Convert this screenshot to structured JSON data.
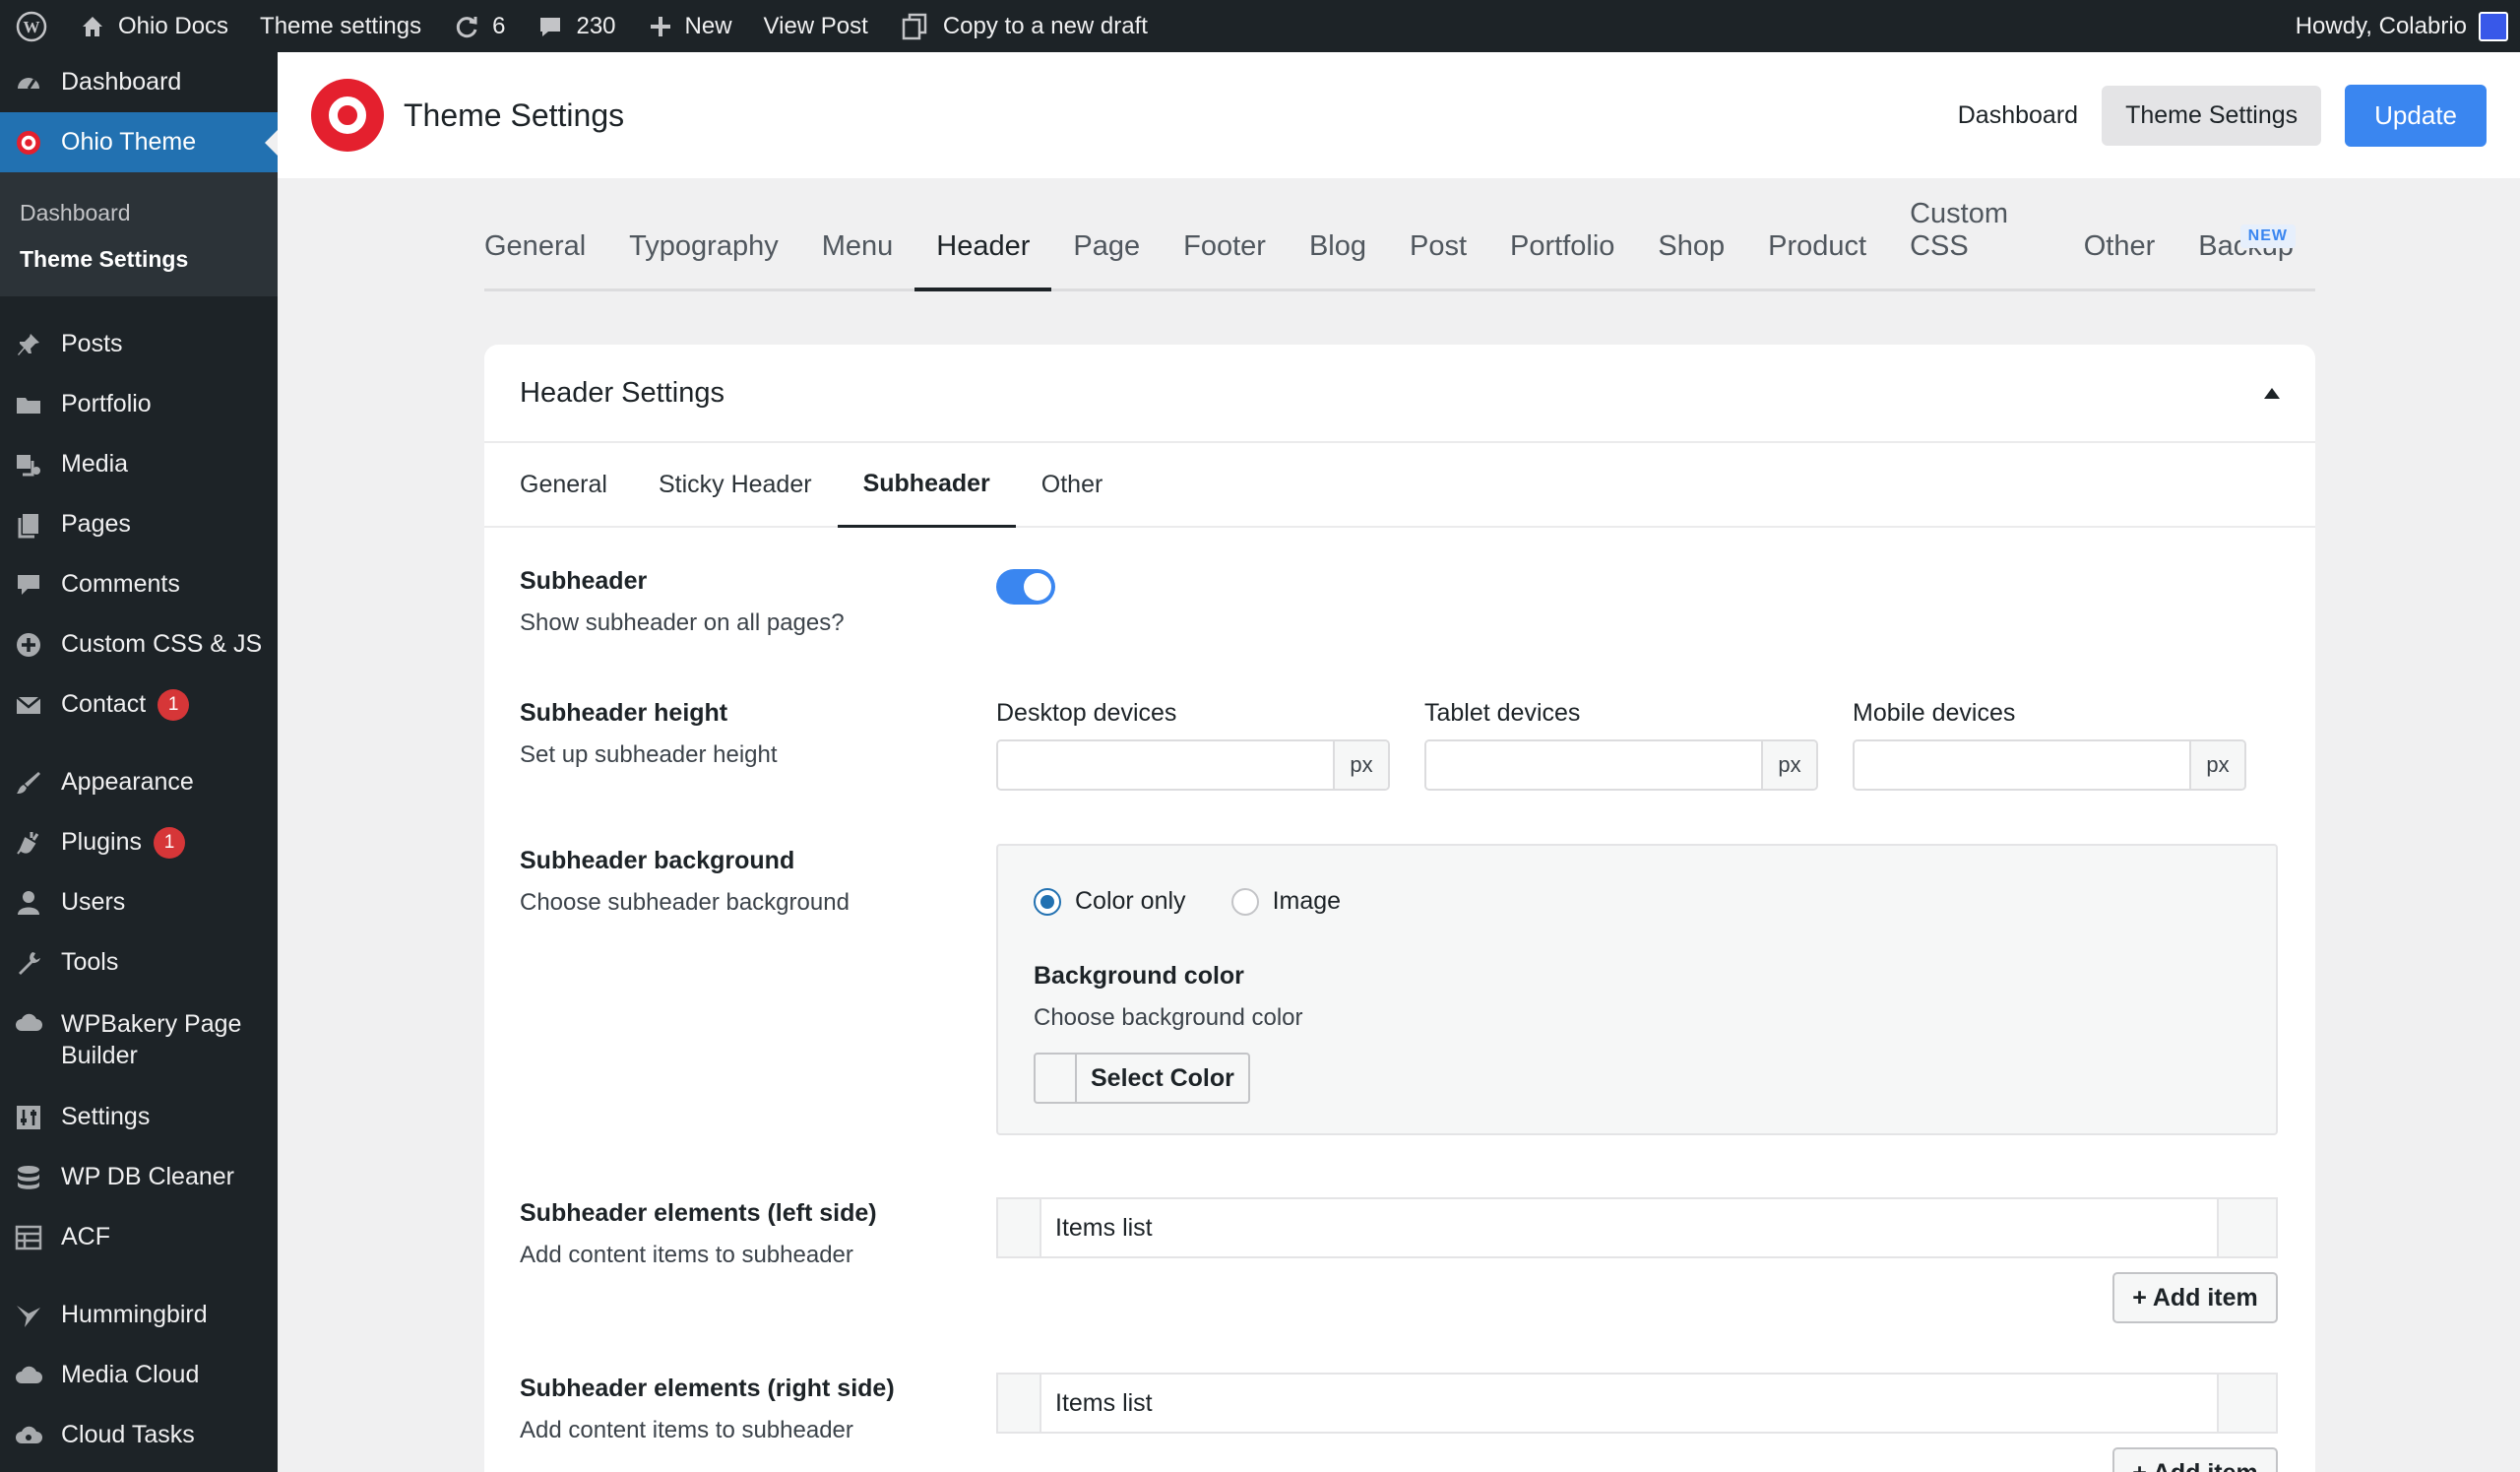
{
  "adminbar": {
    "site_name": "Ohio Docs",
    "theme_settings": "Theme settings",
    "updates_count": "6",
    "comments_count": "230",
    "new_label": "New",
    "view_post": "View Post",
    "copy_draft": "Copy to a new draft",
    "howdy": "Howdy, Colabrio"
  },
  "sidebar": {
    "dashboard": "Dashboard",
    "ohio_theme": "Ohio Theme",
    "sub_dashboard": "Dashboard",
    "sub_theme_settings": "Theme Settings",
    "posts": "Posts",
    "portfolio": "Portfolio",
    "media": "Media",
    "pages": "Pages",
    "comments": "Comments",
    "custom_css_js": "Custom CSS & JS",
    "contact": "Contact",
    "contact_badge": "1",
    "appearance": "Appearance",
    "plugins": "Plugins",
    "plugins_badge": "1",
    "users": "Users",
    "tools": "Tools",
    "wpbakery": "WPBakery Page Builder",
    "settings": "Settings",
    "wp_db_cleaner": "WP DB Cleaner",
    "acf": "ACF",
    "hummingbird": "Hummingbird",
    "media_cloud": "Media Cloud",
    "cloud_tasks": "Cloud Tasks"
  },
  "header": {
    "title": "Theme Settings",
    "dashboard_btn": "Dashboard",
    "theme_settings_btn": "Theme Settings",
    "update_btn": "Update"
  },
  "main_tabs": {
    "general": "General",
    "typography": "Typography",
    "menu": "Menu",
    "header": "Header",
    "page": "Page",
    "footer": "Footer",
    "blog": "Blog",
    "post": "Post",
    "portfolio": "Portfolio",
    "shop": "Shop",
    "product": "Product",
    "custom_css": "Custom CSS",
    "other": "Other",
    "backup": "Backup",
    "new_badge": "NEW"
  },
  "card": {
    "title": "Header Settings",
    "subtabs": {
      "general": "General",
      "sticky": "Sticky Header",
      "subheader": "Subheader",
      "other": "Other"
    },
    "subheader": {
      "label": "Subheader",
      "desc": "Show subheader on all pages?",
      "enabled": true
    },
    "height": {
      "label": "Subheader height",
      "desc": "Set up subheader height",
      "desktop_label": "Desktop devices",
      "tablet_label": "Tablet devices",
      "mobile_label": "Mobile devices",
      "unit": "px"
    },
    "background": {
      "label": "Subheader background",
      "desc": "Choose subheader background",
      "opt_color": "Color only",
      "opt_image": "Image",
      "color_label": "Background color",
      "color_desc": "Choose background color",
      "select_color": "Select Color"
    },
    "left_elements": {
      "label": "Subheader elements (left side)",
      "desc": "Add content items to subheader",
      "list_title": "Items list",
      "add_btn": "+ Add item"
    },
    "right_elements": {
      "label": "Subheader elements (right side)",
      "desc": "Add content items to subheader",
      "list_title": "Items list",
      "add_btn": "+ Add item"
    }
  },
  "colors": {
    "adminbar_bg": "#1d2327",
    "accent_blue": "#3a86f0",
    "wp_blue": "#2271b1",
    "ohio_red": "#e4202e",
    "badge_red": "#d63638"
  }
}
